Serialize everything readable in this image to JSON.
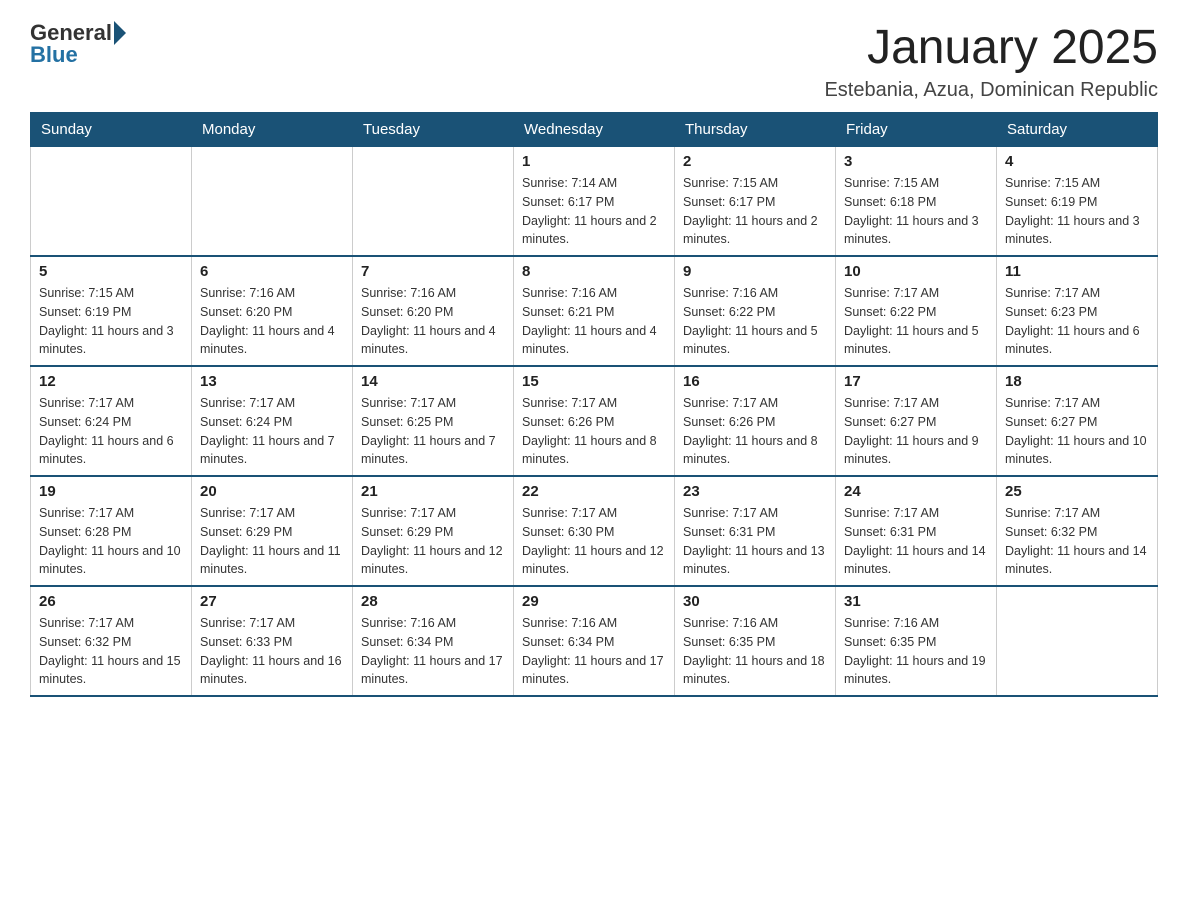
{
  "header": {
    "logo_general": "General",
    "logo_blue": "Blue",
    "title": "January 2025",
    "subtitle": "Estebania, Azua, Dominican Republic"
  },
  "weekdays": [
    "Sunday",
    "Monday",
    "Tuesday",
    "Wednesday",
    "Thursday",
    "Friday",
    "Saturday"
  ],
  "weeks": [
    [
      {
        "day": "",
        "info": ""
      },
      {
        "day": "",
        "info": ""
      },
      {
        "day": "",
        "info": ""
      },
      {
        "day": "1",
        "info": "Sunrise: 7:14 AM\nSunset: 6:17 PM\nDaylight: 11 hours and 2 minutes."
      },
      {
        "day": "2",
        "info": "Sunrise: 7:15 AM\nSunset: 6:17 PM\nDaylight: 11 hours and 2 minutes."
      },
      {
        "day": "3",
        "info": "Sunrise: 7:15 AM\nSunset: 6:18 PM\nDaylight: 11 hours and 3 minutes."
      },
      {
        "day": "4",
        "info": "Sunrise: 7:15 AM\nSunset: 6:19 PM\nDaylight: 11 hours and 3 minutes."
      }
    ],
    [
      {
        "day": "5",
        "info": "Sunrise: 7:15 AM\nSunset: 6:19 PM\nDaylight: 11 hours and 3 minutes."
      },
      {
        "day": "6",
        "info": "Sunrise: 7:16 AM\nSunset: 6:20 PM\nDaylight: 11 hours and 4 minutes."
      },
      {
        "day": "7",
        "info": "Sunrise: 7:16 AM\nSunset: 6:20 PM\nDaylight: 11 hours and 4 minutes."
      },
      {
        "day": "8",
        "info": "Sunrise: 7:16 AM\nSunset: 6:21 PM\nDaylight: 11 hours and 4 minutes."
      },
      {
        "day": "9",
        "info": "Sunrise: 7:16 AM\nSunset: 6:22 PM\nDaylight: 11 hours and 5 minutes."
      },
      {
        "day": "10",
        "info": "Sunrise: 7:17 AM\nSunset: 6:22 PM\nDaylight: 11 hours and 5 minutes."
      },
      {
        "day": "11",
        "info": "Sunrise: 7:17 AM\nSunset: 6:23 PM\nDaylight: 11 hours and 6 minutes."
      }
    ],
    [
      {
        "day": "12",
        "info": "Sunrise: 7:17 AM\nSunset: 6:24 PM\nDaylight: 11 hours and 6 minutes."
      },
      {
        "day": "13",
        "info": "Sunrise: 7:17 AM\nSunset: 6:24 PM\nDaylight: 11 hours and 7 minutes."
      },
      {
        "day": "14",
        "info": "Sunrise: 7:17 AM\nSunset: 6:25 PM\nDaylight: 11 hours and 7 minutes."
      },
      {
        "day": "15",
        "info": "Sunrise: 7:17 AM\nSunset: 6:26 PM\nDaylight: 11 hours and 8 minutes."
      },
      {
        "day": "16",
        "info": "Sunrise: 7:17 AM\nSunset: 6:26 PM\nDaylight: 11 hours and 8 minutes."
      },
      {
        "day": "17",
        "info": "Sunrise: 7:17 AM\nSunset: 6:27 PM\nDaylight: 11 hours and 9 minutes."
      },
      {
        "day": "18",
        "info": "Sunrise: 7:17 AM\nSunset: 6:27 PM\nDaylight: 11 hours and 10 minutes."
      }
    ],
    [
      {
        "day": "19",
        "info": "Sunrise: 7:17 AM\nSunset: 6:28 PM\nDaylight: 11 hours and 10 minutes."
      },
      {
        "day": "20",
        "info": "Sunrise: 7:17 AM\nSunset: 6:29 PM\nDaylight: 11 hours and 11 minutes."
      },
      {
        "day": "21",
        "info": "Sunrise: 7:17 AM\nSunset: 6:29 PM\nDaylight: 11 hours and 12 minutes."
      },
      {
        "day": "22",
        "info": "Sunrise: 7:17 AM\nSunset: 6:30 PM\nDaylight: 11 hours and 12 minutes."
      },
      {
        "day": "23",
        "info": "Sunrise: 7:17 AM\nSunset: 6:31 PM\nDaylight: 11 hours and 13 minutes."
      },
      {
        "day": "24",
        "info": "Sunrise: 7:17 AM\nSunset: 6:31 PM\nDaylight: 11 hours and 14 minutes."
      },
      {
        "day": "25",
        "info": "Sunrise: 7:17 AM\nSunset: 6:32 PM\nDaylight: 11 hours and 14 minutes."
      }
    ],
    [
      {
        "day": "26",
        "info": "Sunrise: 7:17 AM\nSunset: 6:32 PM\nDaylight: 11 hours and 15 minutes."
      },
      {
        "day": "27",
        "info": "Sunrise: 7:17 AM\nSunset: 6:33 PM\nDaylight: 11 hours and 16 minutes."
      },
      {
        "day": "28",
        "info": "Sunrise: 7:16 AM\nSunset: 6:34 PM\nDaylight: 11 hours and 17 minutes."
      },
      {
        "day": "29",
        "info": "Sunrise: 7:16 AM\nSunset: 6:34 PM\nDaylight: 11 hours and 17 minutes."
      },
      {
        "day": "30",
        "info": "Sunrise: 7:16 AM\nSunset: 6:35 PM\nDaylight: 11 hours and 18 minutes."
      },
      {
        "day": "31",
        "info": "Sunrise: 7:16 AM\nSunset: 6:35 PM\nDaylight: 11 hours and 19 minutes."
      },
      {
        "day": "",
        "info": ""
      }
    ]
  ]
}
